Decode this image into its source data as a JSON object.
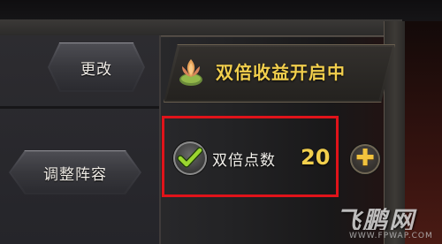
{
  "buttons": {
    "change_label": "更改",
    "lineup_label": "调整阵容"
  },
  "banner": {
    "text": "双倍收益开启中",
    "icon": "lotus-icon"
  },
  "double_points": {
    "label": "双倍点数",
    "value": "20",
    "checked": true,
    "add_icon": "plus-icon"
  },
  "watermark": {
    "main": "飞鹏网",
    "url": "WWW.FPWAP.COM"
  },
  "colors": {
    "accent_gold": "#f2cf4d",
    "highlight_red": "#e0131a",
    "check_green": "#9bd630"
  }
}
